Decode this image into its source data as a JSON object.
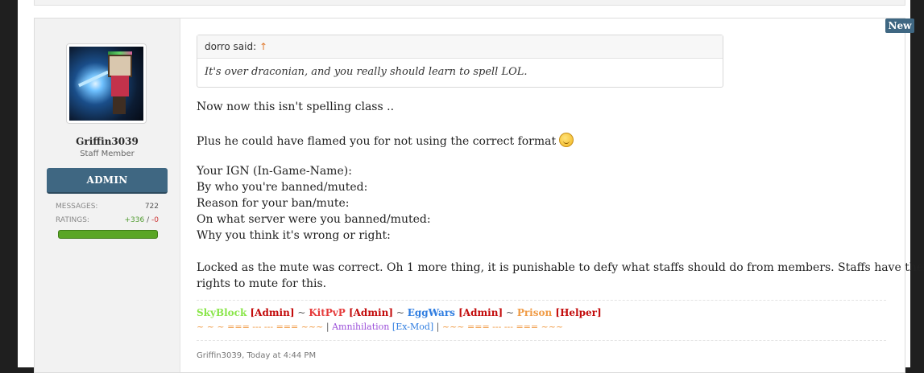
{
  "badge": {
    "new": "New"
  },
  "user": {
    "name": "Griffin3039",
    "title": "Staff Member",
    "banner": "ADMIN",
    "messages_label": "MESSAGES:",
    "messages_value": "722",
    "ratings_label": "RATINGS:",
    "ratings_pos": "+336",
    "ratings_sep": " / ",
    "ratings_neg": "-0",
    "rating_fill_fraction": 1.0
  },
  "quote": {
    "author": "dorro said:",
    "arrow": "↑",
    "text": "It's over draconian, and you really should learn to spell LOL."
  },
  "post": {
    "line1": "Now now this isn't spelling class ..",
    "line2": "Plus he could have flamed you for not using the correct format",
    "form": [
      "Your IGN (In-Game-Name):",
      "By who you're banned/muted:",
      "Reason for your ban/mute:",
      "On what server were you banned/muted:",
      "Why you think it's wrong or right:"
    ],
    "closing1": "Locked as the mute was correct. Oh 1 more thing, it is punishable to defy what staffs should do from members. Staffs have their",
    "closing2": "rights to mute for this.",
    "smiley_icon": "thinking-face-icon"
  },
  "signature": {
    "row1": [
      {
        "t": "SkyBlock",
        "c": "green"
      },
      {
        "t": " [",
        "c": "dred"
      },
      {
        "t": "Admin",
        "c": "dred"
      },
      {
        "t": "]",
        "c": "dred"
      },
      {
        "t": " ~ ",
        "c": "grey"
      },
      {
        "t": "KitPvP",
        "c": "red"
      },
      {
        "t": " [",
        "c": "dred"
      },
      {
        "t": "Admin",
        "c": "dred"
      },
      {
        "t": "]",
        "c": "dred"
      },
      {
        "t": " ~ ",
        "c": "grey"
      },
      {
        "t": "EggWars",
        "c": "blue"
      },
      {
        "t": " [",
        "c": "dred"
      },
      {
        "t": "Admin",
        "c": "dred"
      },
      {
        "t": "]",
        "c": "dred"
      },
      {
        "t": " ~ ",
        "c": "grey"
      },
      {
        "t": "Prison",
        "c": "orange"
      },
      {
        "t": " [",
        "c": "dred"
      },
      {
        "t": "Helper",
        "c": "dred"
      },
      {
        "t": "]",
        "c": "dred"
      }
    ],
    "row2": [
      {
        "t": "~ ~ ~ === --- --- === ~~~ ",
        "c": "orange"
      },
      {
        "t": "| ",
        "c": "grey"
      },
      {
        "t": "Amnihilation",
        "c": "purple"
      },
      {
        "t": " [",
        "c": "blue"
      },
      {
        "t": "Ex-Mod",
        "c": "blue"
      },
      {
        "t": "]",
        "c": "blue"
      },
      {
        "t": " | ",
        "c": "grey"
      },
      {
        "t": "~~~ === --- --- === ~~~",
        "c": "orange"
      }
    ]
  },
  "footer": {
    "meta": "Griffin3039, Today at 4:44 PM"
  }
}
